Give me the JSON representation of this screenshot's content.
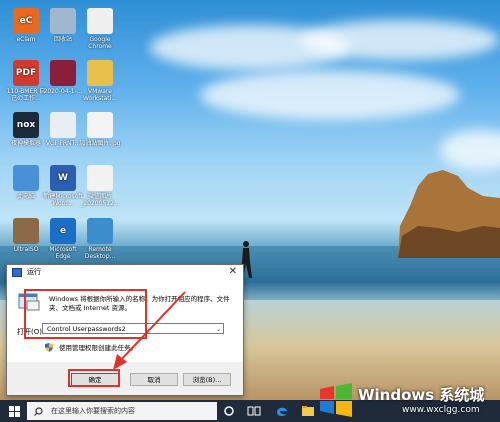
{
  "desktop_icons": [
    {
      "label": "eClam",
      "glyph": "eC",
      "color": "#e86a1e"
    },
    {
      "label": "回收站",
      "glyph": "",
      "color": "#9fb8cf"
    },
    {
      "label": "Google Chrome",
      "glyph": "",
      "color": "#f0f0f0"
    },
    {
      "label": "110-BMER 自己の工作...",
      "glyph": "PDF",
      "color": "#d13b2f"
    },
    {
      "label": "2020-04-1-...",
      "glyph": "",
      "color": "#8a1f3c"
    },
    {
      "label": "VMware Workstati...",
      "glyph": "",
      "color": "#e9c04b"
    },
    {
      "label": "夜神模拟器",
      "glyph": "nox",
      "color": "#1c2b3a"
    },
    {
      "label": "VGI_FRNT...",
      "glyph": "",
      "color": "#e8eef2"
    },
    {
      "label": "加油站图片.jpg",
      "glyph": "",
      "color": "#f4f4f4"
    },
    {
      "label": "此电脑",
      "glyph": "",
      "color": "#4a90d9"
    },
    {
      "label": "新建Microsoft Word...",
      "glyph": "W",
      "color": "#2b5fb0"
    },
    {
      "label": "微信图片_20200512...",
      "glyph": "",
      "color": "#f2f2f2"
    },
    {
      "label": "UltraISO",
      "glyph": "",
      "color": "#8b6a4a"
    },
    {
      "label": "Microsoft Edge",
      "glyph": "e",
      "color": "#1a6fc4"
    },
    {
      "label": "Remote Desktop...",
      "glyph": "",
      "color": "#3c8dcc"
    }
  ],
  "run_dialog": {
    "title": "运行",
    "close": "✕",
    "description": "Windows 将根据你所输入的名称，为你打开相应的程序、文件夹、文档或 Internet 资源。",
    "open_label": "打开(O):",
    "input_value": "Control Userpasswords2",
    "admin_text": "使用管理权限创建此任务。",
    "ok": "确定",
    "cancel": "取消",
    "browse": "浏览(B)..."
  },
  "taskbar": {
    "search_placeholder": "在这里输入你要搜索的内容"
  },
  "watermark": {
    "title": "Windows 系统城",
    "url": "www.wxclgg.com"
  },
  "colors": {
    "annotation_red": "#e0312a",
    "taskbar": "#1f2a3a",
    "accent": "#0078d7"
  }
}
